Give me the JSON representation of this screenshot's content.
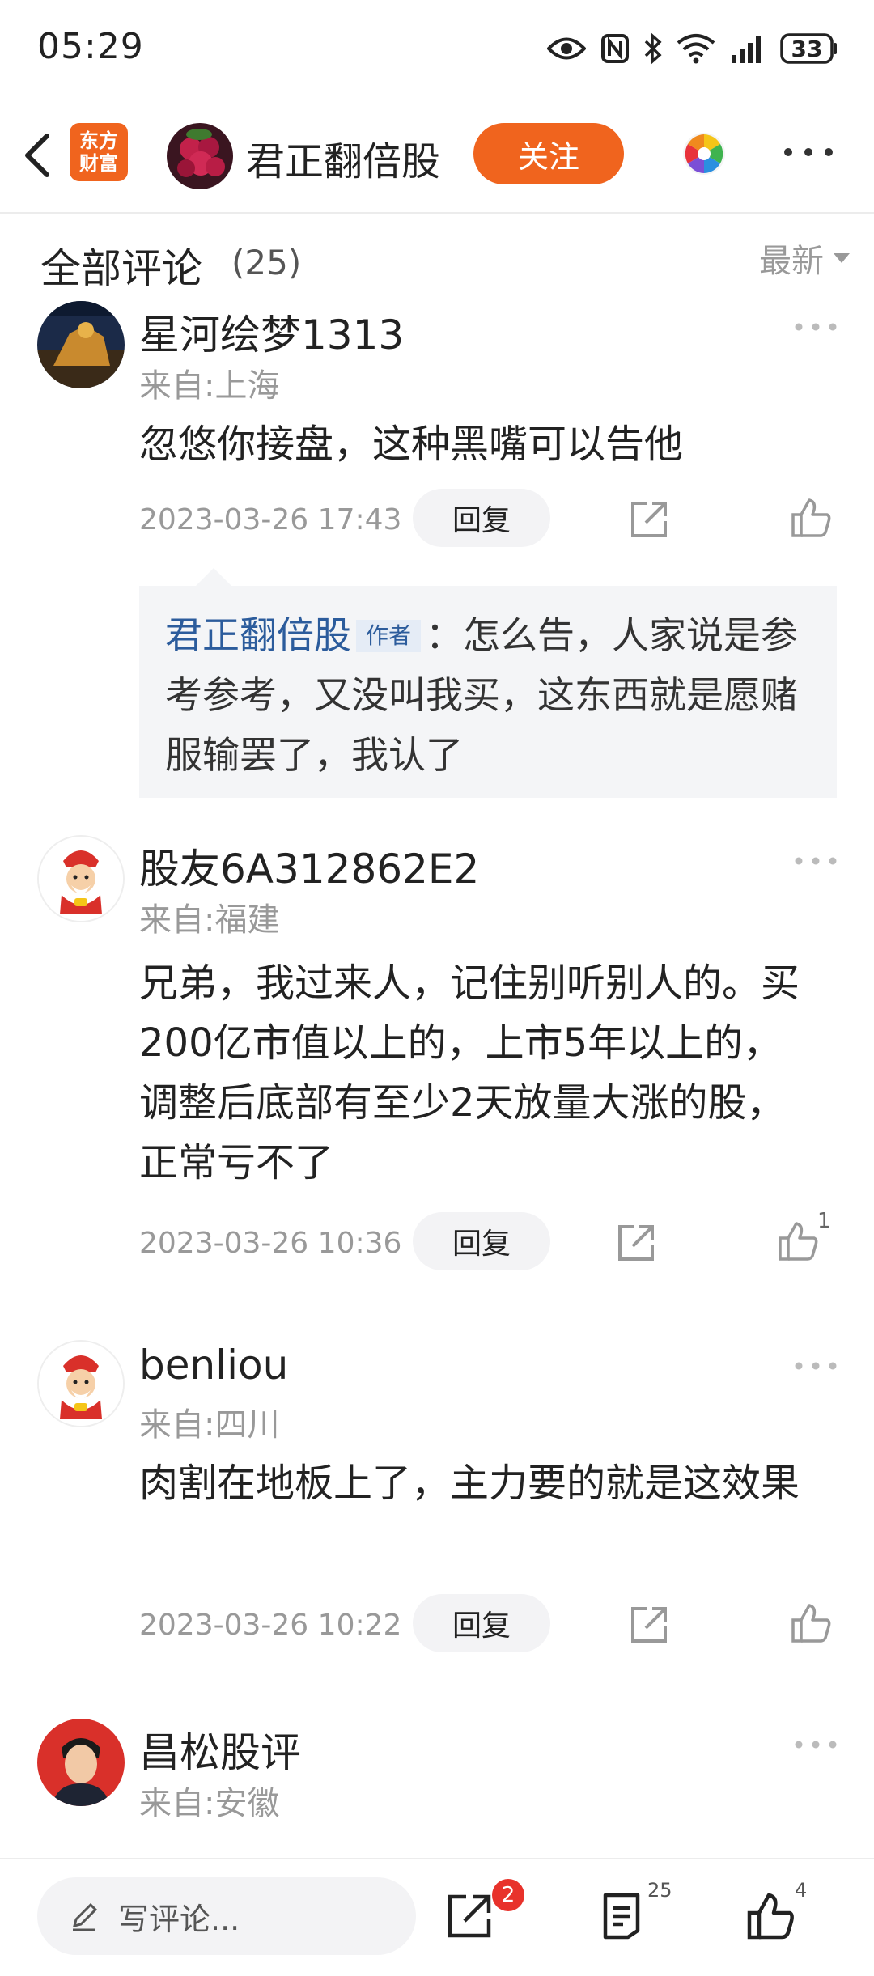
{
  "status_bar": {
    "time": "05:29",
    "battery": "33"
  },
  "header": {
    "logo_text_line1": "东方",
    "logo_text_line2": "财富",
    "title": "君正翻倍股",
    "follow_label": "关注"
  },
  "section": {
    "title": "全部评论",
    "count": "(25)",
    "sort_label": "最新"
  },
  "comments": [
    {
      "name": "星河绘梦1313",
      "location": "来自:上海",
      "text": "忽悠你接盘，这种黑嘴可以告他",
      "time": "2023-03-26 17:43",
      "reply_label": "回复",
      "like_count": "",
      "reply": {
        "author": "君正翻倍股",
        "badge": "作者",
        "text": "：怎么告，人家说是参考参考，又没叫我买，这东西就是愿赌服输罢了，我认了"
      }
    },
    {
      "name": "股友6A312862E2",
      "location": "来自:福建",
      "text": "兄弟，我过来人，记住别听别人的。买200亿市值以上的，上市5年以上的，调整后底部有至少2天放量大涨的股，正常亏不了",
      "time": "2023-03-26 10:36",
      "reply_label": "回复",
      "like_count": "1"
    },
    {
      "name": "benliou",
      "location": "来自:四川",
      "text": "肉割在地板上了，主力要的就是这效果",
      "time": "2023-03-26 10:22",
      "reply_label": "回复",
      "like_count": ""
    },
    {
      "name": "昌松股评",
      "location": "来自:安徽",
      "text": "",
      "time": "",
      "reply_label": "",
      "like_count": ""
    }
  ],
  "bottom_bar": {
    "write_placeholder": "写评论...",
    "share_badge": "2",
    "comments_count": "25",
    "likes_count": "4"
  },
  "colors": {
    "accent": "#f0641e",
    "author_blue": "#2c5c9c",
    "badge_red": "#e8322b"
  }
}
